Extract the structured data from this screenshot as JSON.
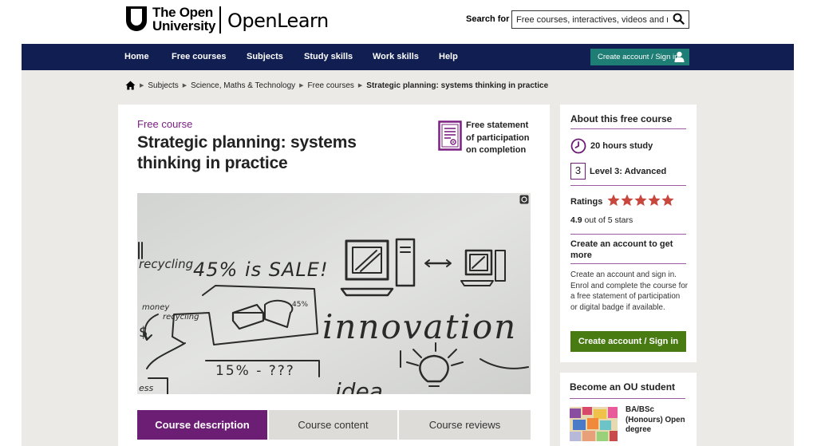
{
  "brand": {
    "ou_logo_line1": "The Open",
    "ou_logo_line2": "University",
    "openlearn": "OpenLearn"
  },
  "search": {
    "label": "Search for",
    "placeholder": "Free courses, interactives, videos and more",
    "icon": "search-icon"
  },
  "nav": {
    "items": [
      "Home",
      "Free courses",
      "Subjects",
      "Study skills",
      "Work skills",
      "Help"
    ],
    "account_button": "Create account / Sign in",
    "account_icon": "user-icon"
  },
  "breadcrumb": {
    "home_icon": "home-icon",
    "items": [
      "Subjects",
      "Science, Maths & Technology",
      "Free courses"
    ],
    "current": "Strategic planning: systems thinking in practice"
  },
  "course": {
    "kicker": "Free course",
    "title": "Strategic planning: systems thinking in practice",
    "certificate_text": "Free statement of participation on completion",
    "certificate_icon": "certificate-icon",
    "image_fullscreen_icon": "expand-icon",
    "hero_whiteboard_text": {
      "recycling": "recycling",
      "sale": "45% is SALE!",
      "money": "money",
      "recycling_small": "recycling",
      "dollar": "$",
      "percent_small": "45%",
      "innovation": "innovation",
      "formula": "15% - ???",
      "idea": "idea",
      "ess": "ess"
    }
  },
  "tabs": [
    {
      "label": "Course description",
      "active": true
    },
    {
      "label": "Course content",
      "active": false
    },
    {
      "label": "Course reviews",
      "active": false
    }
  ],
  "about": {
    "title": "About this free course",
    "duration": "20 hours study",
    "duration_icon": "clock-icon",
    "level_number": "3",
    "level": "Level 3: Advanced",
    "ratings_label": "Ratings",
    "rating_value": "4.9",
    "rating_suffix": "out of 5 stars",
    "stars": 5,
    "star_color": "#c8463c",
    "create_heading": "Create an account to get more",
    "create_desc": "Create an account and sign in. Enrol and complete the course for a free statement of participation or digital badge if available.",
    "signin_button": "Create account / Sign in"
  },
  "ou_student": {
    "title": "Become an OU student",
    "degree": "BA/BSc (Honours) Open degree"
  },
  "colors": {
    "navy": "#101e52",
    "purple": "#7b2082",
    "tab_active": "#6c1d74",
    "teal": "#1e7d74",
    "green": "#497b13",
    "content_bg": "#eceae6"
  }
}
